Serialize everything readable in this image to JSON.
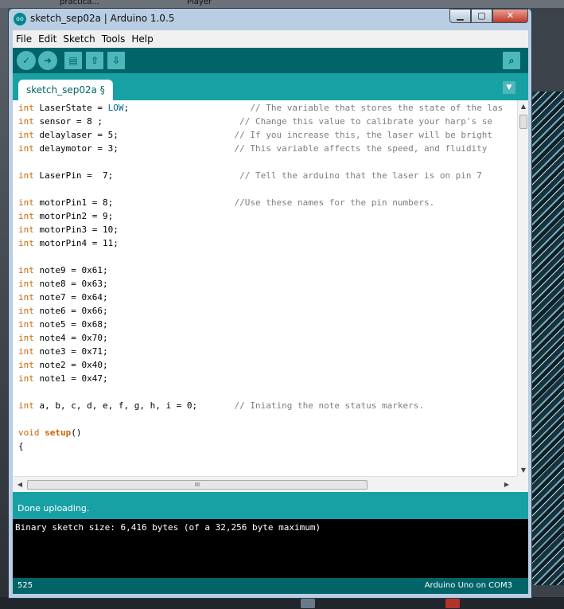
{
  "desktop": {
    "top_labels": [
      "practica...",
      "Player"
    ]
  },
  "window": {
    "title": "sketch_sep02a | Arduino 1.0.5",
    "app_logo": "oo",
    "controls": {
      "minimize": "▁",
      "maximize": "▢",
      "close": "✕"
    }
  },
  "menubar": [
    "File",
    "Edit",
    "Sketch",
    "Tools",
    "Help"
  ],
  "toolbar": {
    "verify_icon": "✓",
    "upload_icon": "➜",
    "new_icon": "▤",
    "open_icon": "⇧",
    "save_icon": "⇩",
    "serial_icon": "⌕"
  },
  "tabs": [
    {
      "label": "sketch_sep02a §"
    }
  ],
  "tab_menu_icon": "▼",
  "code": [
    [
      {
        "t": "int",
        "c": "kw"
      },
      {
        "t": " LaserState = "
      },
      {
        "t": "LOW",
        "c": "const"
      },
      {
        "t": ";                       "
      },
      {
        "t": "// The variable that stores the state of the las",
        "c": "cm"
      }
    ],
    [
      {
        "t": "int",
        "c": "kw"
      },
      {
        "t": " sensor = 8 ;                          "
      },
      {
        "t": "// Change this value to calibrate your harp's se",
        "c": "cm"
      }
    ],
    [
      {
        "t": "int",
        "c": "kw"
      },
      {
        "t": " delaylaser = 5;                      "
      },
      {
        "t": "// If you increase this, the laser will be bright",
        "c": "cm"
      }
    ],
    [
      {
        "t": "int",
        "c": "kw"
      },
      {
        "t": " delaymotor = 3;                      "
      },
      {
        "t": "// This variable affects the speed, and fluidity",
        "c": "cm"
      }
    ],
    [],
    [
      {
        "t": "int",
        "c": "kw"
      },
      {
        "t": " LaserPin =  7;                        "
      },
      {
        "t": "// Tell the arduino that the laser is on pin 7",
        "c": "cm"
      }
    ],
    [],
    [
      {
        "t": "int",
        "c": "kw"
      },
      {
        "t": " motorPin1 = 8;                       "
      },
      {
        "t": "//Use these names for the pin numbers.",
        "c": "cm"
      }
    ],
    [
      {
        "t": "int",
        "c": "kw"
      },
      {
        "t": " motorPin2 = 9;"
      }
    ],
    [
      {
        "t": "int",
        "c": "kw"
      },
      {
        "t": " motorPin3 = 10;"
      }
    ],
    [
      {
        "t": "int",
        "c": "kw"
      },
      {
        "t": " motorPin4 = 11;"
      }
    ],
    [],
    [
      {
        "t": "int",
        "c": "kw"
      },
      {
        "t": " note9 = 0x61;"
      }
    ],
    [
      {
        "t": "int",
        "c": "kw"
      },
      {
        "t": " note8 = 0x63;"
      }
    ],
    [
      {
        "t": "int",
        "c": "kw"
      },
      {
        "t": " note7 = 0x64;"
      }
    ],
    [
      {
        "t": "int",
        "c": "kw"
      },
      {
        "t": " note6 = 0x66;"
      }
    ],
    [
      {
        "t": "int",
        "c": "kw"
      },
      {
        "t": " note5 = 0x68;"
      }
    ],
    [
      {
        "t": "int",
        "c": "kw"
      },
      {
        "t": " note4 = 0x70;"
      }
    ],
    [
      {
        "t": "int",
        "c": "kw"
      },
      {
        "t": " note3 = 0x71;"
      }
    ],
    [
      {
        "t": "int",
        "c": "kw"
      },
      {
        "t": " note2 = 0x40;"
      }
    ],
    [
      {
        "t": "int",
        "c": "kw"
      },
      {
        "t": " note1 = 0x47;"
      }
    ],
    [],
    [
      {
        "t": "int",
        "c": "kw"
      },
      {
        "t": " a, b, c, d, e, f, g, h, i = 0;       "
      },
      {
        "t": "// Iniating the note status markers.",
        "c": "cm"
      }
    ],
    [],
    [
      {
        "t": "void",
        "c": "kw"
      },
      {
        "t": " "
      },
      {
        "t": "setup",
        "c": "kwb"
      },
      {
        "t": "()"
      }
    ],
    [
      {
        "t": "{"
      }
    ]
  ],
  "scroll": {
    "up": "▲",
    "down": "▼",
    "left": "◀",
    "right": "▶",
    "grip": "III"
  },
  "status_message": "Done uploading.",
  "console": "Binary sketch size: 6,416 bytes (of a 32,256 byte maximum)",
  "footer": {
    "line_number": "525",
    "board": "Arduino Uno on COM3"
  }
}
